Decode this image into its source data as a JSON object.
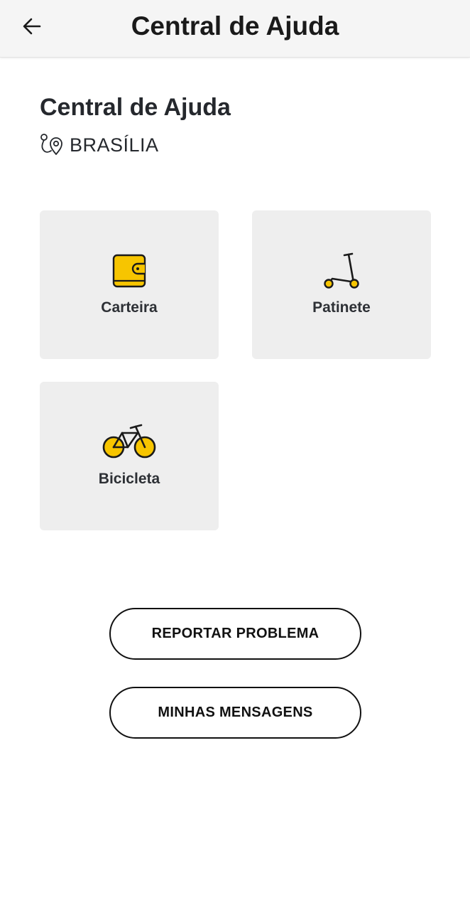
{
  "header": {
    "title": "Central de Ajuda",
    "back_icon": "arrow-left-icon"
  },
  "main": {
    "title": "Central de Ajuda",
    "location": {
      "icon": "route-pin-icon",
      "label": "BRASÍLIA"
    },
    "categories": [
      {
        "label": "Carteira",
        "icon": "wallet-icon"
      },
      {
        "label": "Patinete",
        "icon": "scooter-icon"
      },
      {
        "label": "Bicicleta",
        "icon": "bicycle-icon"
      }
    ],
    "buttons": {
      "report": "REPORTAR PROBLEMA",
      "messages": "MINHAS MENSAGENS"
    }
  },
  "colors": {
    "accent": "#f7c500",
    "header_bg": "#f5f5f5",
    "card_bg": "#eeeeee",
    "text": "#1f2329"
  }
}
